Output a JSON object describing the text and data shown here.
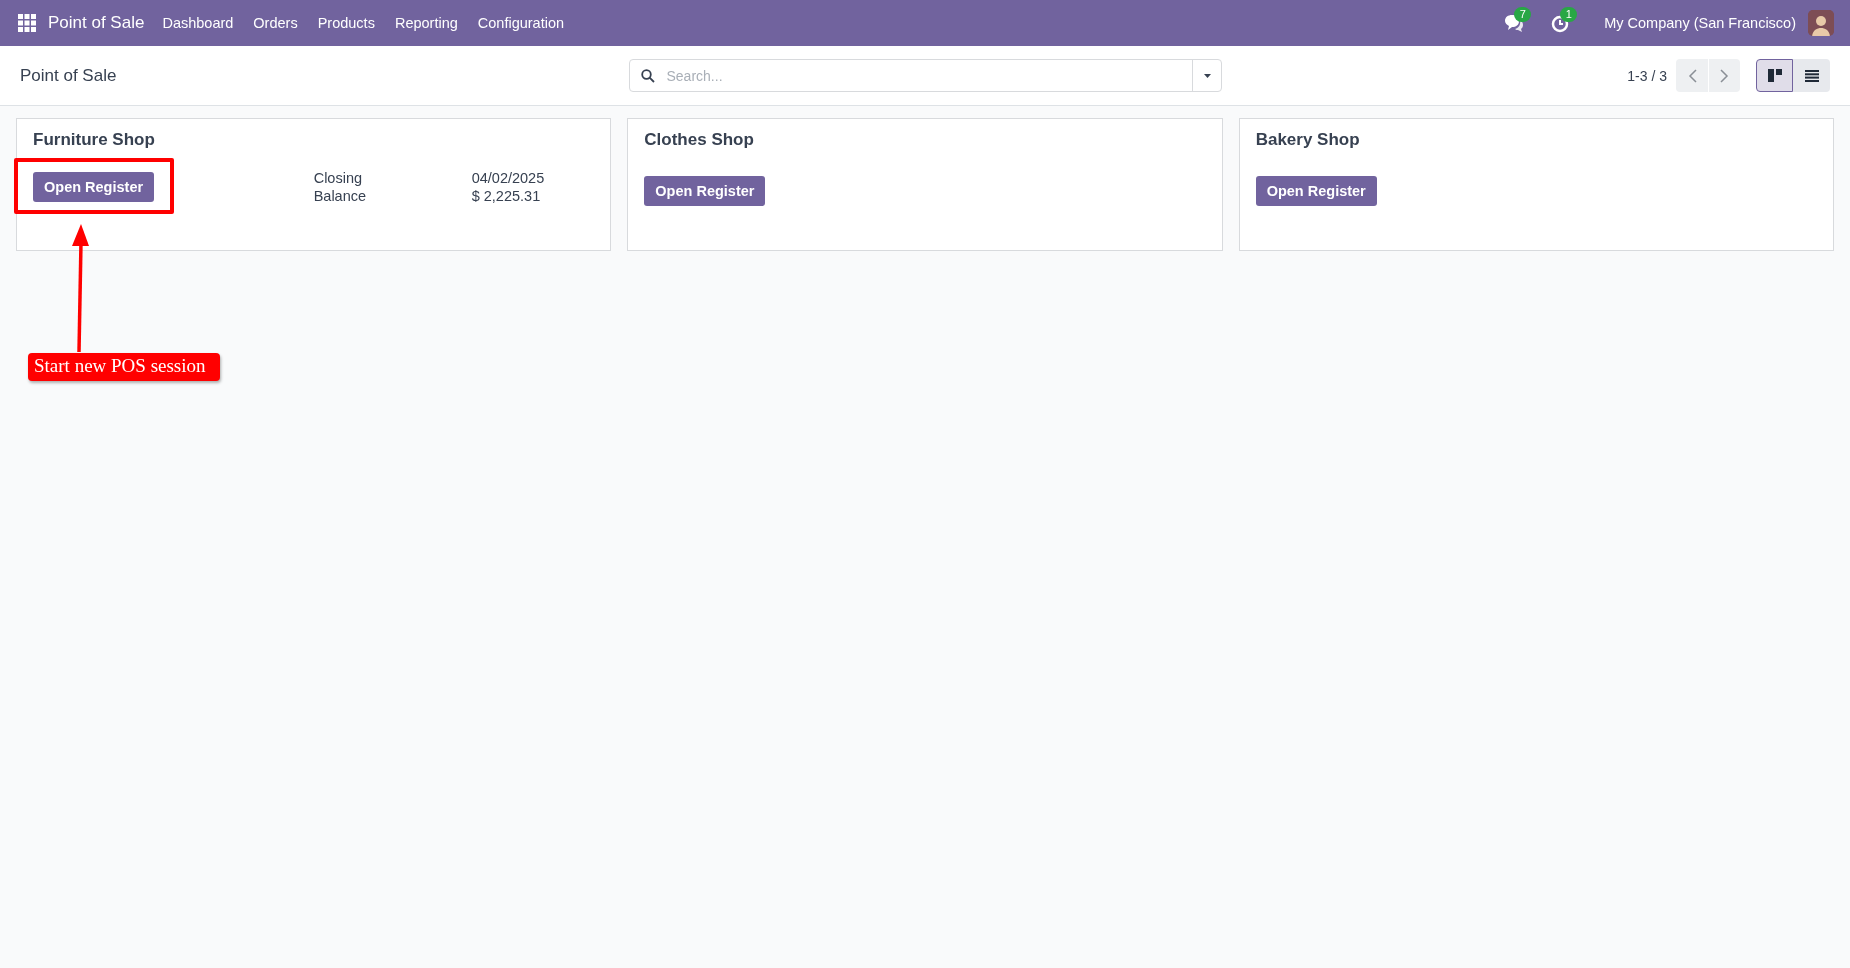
{
  "navbar": {
    "app_name": "Point of Sale",
    "menu": [
      {
        "label": "Dashboard"
      },
      {
        "label": "Orders"
      },
      {
        "label": "Products"
      },
      {
        "label": "Reporting"
      },
      {
        "label": "Configuration"
      }
    ],
    "messages_badge": "7",
    "activity_badge": "1",
    "company": "My Company (San Francisco)"
  },
  "control_panel": {
    "breadcrumb": "Point of Sale",
    "search": {
      "placeholder": "Search..."
    },
    "pager": "1-3 / 3",
    "views": [
      {
        "kind": "kanban",
        "selected": true
      },
      {
        "kind": "list",
        "selected": false
      }
    ]
  },
  "cards": [
    {
      "name": "Furniture Shop",
      "button": "Open Register",
      "highlighted": true,
      "details": [
        {
          "label": "Closing",
          "value": "04/02/2025"
        },
        {
          "label": "Balance",
          "value": "$ 2,225.31"
        }
      ]
    },
    {
      "name": "Clothes Shop",
      "button": "Open Register",
      "highlighted": false
    },
    {
      "name": "Bakery Shop",
      "button": "Open Register",
      "highlighted": false
    }
  ],
  "annotation": {
    "text": "Start new POS session"
  }
}
